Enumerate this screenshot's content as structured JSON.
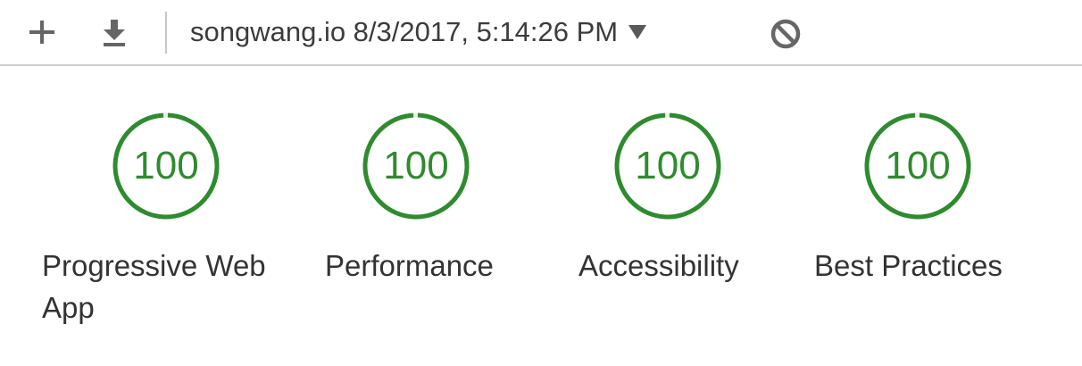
{
  "toolbar": {
    "icons": {
      "add": "plus-icon",
      "download": "download-icon",
      "clear": "no-entry-icon"
    },
    "report_selector": "songwang.io 8/3/2017, 5:14:26 PM"
  },
  "colors": {
    "score_good": "#2e8b2e",
    "track": "#e8efe8",
    "divider": "#cfcfcf"
  },
  "gauges": [
    {
      "score": "100",
      "label": "Progressive Web App",
      "fraction": 1.0
    },
    {
      "score": "100",
      "label": "Performance",
      "fraction": 1.0
    },
    {
      "score": "100",
      "label": "Accessibility",
      "fraction": 1.0
    },
    {
      "score": "100",
      "label": "Best Practices",
      "fraction": 1.0
    }
  ]
}
